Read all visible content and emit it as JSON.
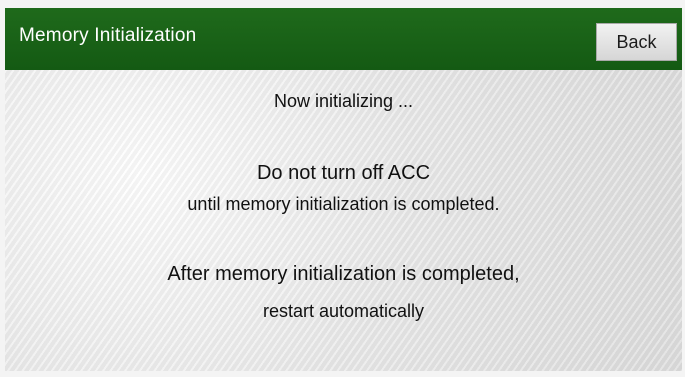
{
  "header": {
    "title": "Memory Initialization",
    "back_label": "Back"
  },
  "message": {
    "status": "Now initializing ...",
    "warning_line1": "Do not turn off ACC",
    "warning_line2": "until memory initialization is completed.",
    "info_line1": "After memory initialization is completed,",
    "info_line2": "restart automatically"
  },
  "colors": {
    "header_bg": "#1f6a1b",
    "content_bg": "#e6e6e6",
    "button_bg": "#e6e6e6"
  }
}
